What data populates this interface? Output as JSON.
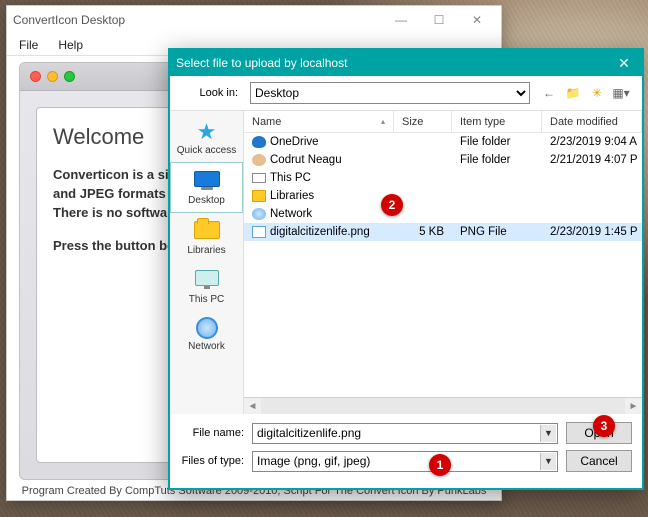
{
  "app": {
    "title": "ConvertIcon Desktop",
    "menu": {
      "file": "File",
      "help": "Help"
    },
    "welcome_heading": "Welcome",
    "intro_line1": "Converticon is a simple icon utility. It can import ICO, PNG, GIF, and JPEG formats and export to ICO, PNG, GIF, JPEG, and BMP. There is no software to download or install, everything is online.",
    "intro_line2": "Press the button below to get started.",
    "footer": "Program Created By CompTuts Software 2009-2010, Script For The Convert Icon By PunkLabs"
  },
  "dialog": {
    "title": "Select file to upload by localhost",
    "look_in_label": "Look in:",
    "look_in_value": "Desktop",
    "places": {
      "quick_access": "Quick access",
      "desktop": "Desktop",
      "libraries": "Libraries",
      "this_pc": "This PC",
      "network": "Network"
    },
    "columns": {
      "name": "Name",
      "size": "Size",
      "item_type": "Item type",
      "date_modified": "Date modified"
    },
    "rows": [
      {
        "name": "OneDrive",
        "size": "",
        "type": "File folder",
        "date": "2/23/2019 9:04 A",
        "icon": "cloud"
      },
      {
        "name": "Codrut Neagu",
        "size": "",
        "type": "File folder",
        "date": "2/21/2019 4:07 P",
        "icon": "user"
      },
      {
        "name": "This PC",
        "size": "",
        "type": "",
        "date": "",
        "icon": "pc"
      },
      {
        "name": "Libraries",
        "size": "",
        "type": "",
        "date": "",
        "icon": "folder"
      },
      {
        "name": "Network",
        "size": "",
        "type": "",
        "date": "",
        "icon": "net"
      },
      {
        "name": "digitalcitizenlife.png",
        "size": "5 KB",
        "type": "PNG File",
        "date": "2/23/2019 1:45 P",
        "icon": "img",
        "selected": true
      }
    ],
    "file_name_label": "File name:",
    "file_name_value": "digitalcitizenlife.png",
    "files_of_type_label": "Files of type:",
    "files_of_type_value": "Image (png, gif, jpeg)",
    "open_button": "Open",
    "cancel_button": "Cancel"
  },
  "callouts": {
    "c1": "1",
    "c2": "2",
    "c3": "3"
  }
}
